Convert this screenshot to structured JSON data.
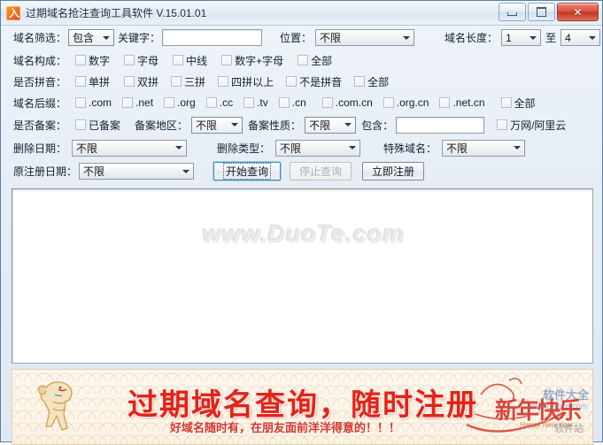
{
  "window": {
    "title": "过期域名抢注查询工具软件 V.15.01.01",
    "icon": "app-icon",
    "controls": {
      "minimize": "minimize-icon",
      "maximize": "maximize-icon",
      "close": "✕"
    }
  },
  "form": {
    "row_filter": {
      "label": "域名筛选：",
      "mode_value": "包含",
      "keyword_label": "关键字：",
      "keyword_value": "",
      "keyword_placeholder": "",
      "position_label": "位置：",
      "position_value": "不限",
      "length_label": "域名长度：",
      "length_from": "1",
      "length_to_label": "至",
      "length_to": "4"
    },
    "row_compose": {
      "label": "域名构成：",
      "options": [
        "数字",
        "字母",
        "中线",
        "数字+字母",
        "全部"
      ]
    },
    "row_pinyin": {
      "label": "是否拼音：",
      "options": [
        "单拼",
        "双拼",
        "三拼",
        "四拼以上",
        "不是拼音",
        "全部"
      ]
    },
    "row_suffix": {
      "label": "域名后缀：",
      "options": [
        ".com",
        ".net",
        ".org",
        ".cc",
        ".tv",
        ".cn",
        ".com.cn",
        ".org.cn",
        ".net.cn",
        "全部"
      ]
    },
    "row_icp": {
      "label": "是否备案：",
      "filed_option": "已备案",
      "region_label": "备案地区：",
      "region_value": "不限",
      "nature_label": "备案性质：",
      "nature_value": "不限",
      "contains_label": "包含：",
      "contains_value": "",
      "wanwang_option": "万网/阿里云"
    },
    "row_delete": {
      "date_label": "删除日期：",
      "date_value": "不限",
      "type_label": "删除类型：",
      "type_value": "不限",
      "special_label": "特殊域名：",
      "special_value": "不限"
    },
    "row_actions": {
      "reg_date_label": "原注册日期：",
      "reg_date_value": "不限",
      "start_button": "开始查询",
      "stop_button": "停止查询",
      "register_button": "立即注册"
    }
  },
  "results": {
    "watermark": "www.DuoTe.com",
    "rows": []
  },
  "banner": {
    "title": "过期域名查询，随时注册",
    "subtitle": "好域名随时有，在朋友面前洋洋得意的！！！",
    "newyear_text": "新年快乐",
    "newyear_en": "Happy New Year",
    "overlay_mark": "软件大全",
    "overlay_mark2": "www.DuoTe.com",
    "overlay_mark3": "软件站",
    "goat": "goat-illustration"
  },
  "colors": {
    "accent_red": "#e2231a",
    "focus_blue": "#3c8dbc",
    "title_text": "#1b2b3a",
    "close_red": "#c23520"
  }
}
